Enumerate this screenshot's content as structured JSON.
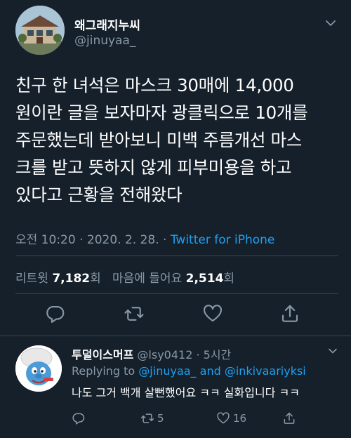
{
  "tweet": {
    "author_name": "왜그래지누씨",
    "author_handle": "@jinuyaa_",
    "lines": [
      "친구 한 녀석은 마스크 30매에 14,000",
      "원이란 글을 보자마자 광클릭으로 10개를",
      "주문했는데 받아보니 미백 주름개선 마스",
      "크를 받고 뜻하지 않게  피부미용을 하고",
      "있다고 근황을 전해왔다"
    ],
    "timestamp": "오전 10:20 · 2020. 2. 28. · ",
    "source": "Twitter for iPhone",
    "retweets_label": "리트윗",
    "retweets_count": "7,182",
    "retweets_unit": "회",
    "likes_label": "마음에 들어요",
    "likes_count": "2,514",
    "likes_unit": "회"
  },
  "reply": {
    "author_name": "투덜이스머프",
    "author_handle": "@lsy0412 · 5시간",
    "replying_prefix": "Replying to ",
    "mention1": "@jinuyaa_",
    "and_text": " and ",
    "mention2": "@inkivaariyksi",
    "text": "나도 그거 백개 살뻔했어요 ㅋㅋ 실화입니다 ㅋㅋ",
    "retweet_count": "5",
    "like_count": "16"
  },
  "colors": {
    "background": "#15202b",
    "secondary_text": "#8899a6",
    "accent": "#1da1f2",
    "divider": "#38444d"
  },
  "icons": [
    "chevron-down-icon",
    "reply-icon",
    "retweet-icon",
    "like-icon",
    "share-icon"
  ]
}
